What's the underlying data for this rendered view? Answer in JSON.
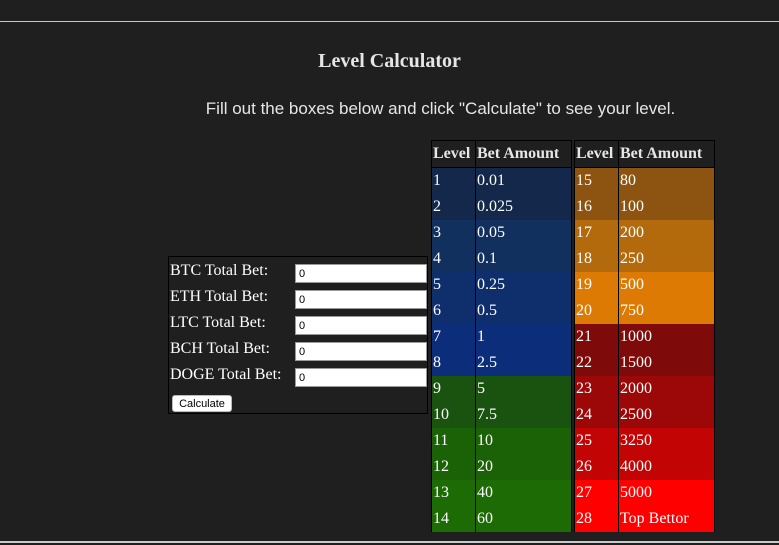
{
  "page": {
    "title": "Level Calculator",
    "instructions": "Fill out the boxes below and click \"Calculate\" to see your level."
  },
  "form": {
    "fields": [
      {
        "label": "BTC Total Bet:",
        "value": "0"
      },
      {
        "label": "ETH Total Bet:",
        "value": "0"
      },
      {
        "label": "LTC Total Bet:",
        "value": "0"
      },
      {
        "label": "BCH Total Bet:",
        "value": "0"
      },
      {
        "label": "DOGE Total Bet:",
        "value": "0"
      }
    ],
    "button_label": "Calculate"
  },
  "levels_table": {
    "headers": [
      "Level",
      "Bet Amount",
      "Level",
      "Bet Amount"
    ],
    "left": [
      {
        "level": "1",
        "bet": "0.01",
        "color": "#13284a"
      },
      {
        "level": "2",
        "bet": "0.025",
        "color": "#13284a"
      },
      {
        "level": "3",
        "bet": "0.05",
        "color": "#11305e"
      },
      {
        "level": "4",
        "bet": "0.1",
        "color": "#11305e"
      },
      {
        "level": "5",
        "bet": "0.25",
        "color": "#0f2e6c"
      },
      {
        "level": "6",
        "bet": "0.5",
        "color": "#0f2e6c"
      },
      {
        "level": "7",
        "bet": "1",
        "color": "#0c2d7a"
      },
      {
        "level": "8",
        "bet": "2.5",
        "color": "#0c2d7a"
      },
      {
        "level": "9",
        "bet": "5",
        "color": "#1a5210"
      },
      {
        "level": "10",
        "bet": "7.5",
        "color": "#1a5210"
      },
      {
        "level": "11",
        "bet": "10",
        "color": "#1b6207"
      },
      {
        "level": "12",
        "bet": "20",
        "color": "#1b6207"
      },
      {
        "level": "13",
        "bet": "40",
        "color": "#1c6b05"
      },
      {
        "level": "14",
        "bet": "60",
        "color": "#1c6b05"
      }
    ],
    "right": [
      {
        "level": "15",
        "bet": "80",
        "color": "#8c5410"
      },
      {
        "level": "16",
        "bet": "100",
        "color": "#8c5410"
      },
      {
        "level": "17",
        "bet": "200",
        "color": "#b26a0c"
      },
      {
        "level": "18",
        "bet": "250",
        "color": "#b26a0c"
      },
      {
        "level": "19",
        "bet": "500",
        "color": "#dd7a03"
      },
      {
        "level": "20",
        "bet": "750",
        "color": "#dd7a03"
      },
      {
        "level": "21",
        "bet": "1000",
        "color": "#7e0a0a"
      },
      {
        "level": "22",
        "bet": "1500",
        "color": "#7e0a0a"
      },
      {
        "level": "23",
        "bet": "2000",
        "color": "#9c0808"
      },
      {
        "level": "24",
        "bet": "2500",
        "color": "#9c0808"
      },
      {
        "level": "25",
        "bet": "3250",
        "color": "#c20404"
      },
      {
        "level": "26",
        "bet": "4000",
        "color": "#c20404"
      },
      {
        "level": "27",
        "bet": "5000",
        "color": "#ff0000"
      },
      {
        "level": "28",
        "bet": "Top Bettor",
        "color": "#ff0000"
      }
    ]
  }
}
